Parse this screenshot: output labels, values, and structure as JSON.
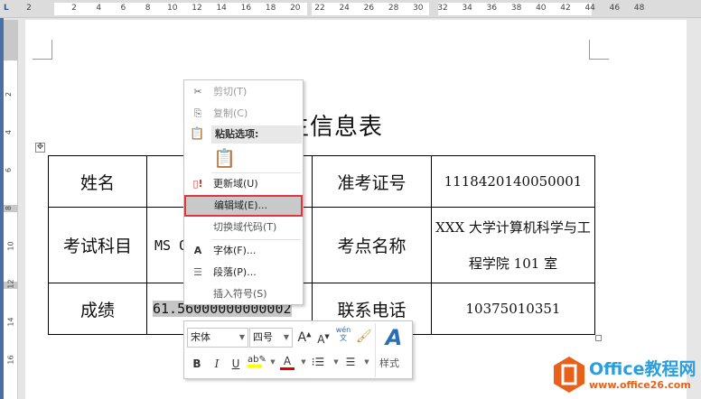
{
  "ruler": {
    "h_left": [
      "2"
    ],
    "h_numbers": [
      "2",
      "4",
      "6",
      "8",
      "10",
      "12",
      "14",
      "16",
      "18",
      "20",
      "22",
      "24",
      "26",
      "28",
      "30",
      "32",
      "34",
      "36",
      "38",
      "40",
      "42",
      "44",
      "46",
      "48"
    ],
    "v_numbers": [
      "2",
      "4",
      "6",
      "8",
      "10",
      "12",
      "14",
      "16"
    ],
    "tab_selector": "L"
  },
  "document": {
    "title": "考生信息表",
    "table": [
      [
        "姓名",
        "",
        "准考证号",
        "1118420140050001"
      ],
      [
        "考试科目",
        "MS Office",
        "考点名称",
        "XXX 大学计算机科学与工程学院 101 室"
      ],
      [
        "成绩",
        "61.56000000000002",
        "联系电话",
        "10375010351"
      ]
    ]
  },
  "context_menu": {
    "items": [
      {
        "label": "剪切(T)",
        "icon": "scissors-icon",
        "disabled": true
      },
      {
        "label": "复制(C)",
        "icon": "copy-icon",
        "disabled": true
      },
      {
        "label": "粘贴选项:",
        "icon": "paste-icon"
      },
      {
        "label": "更新域(U)",
        "icon": "update-field-icon"
      },
      {
        "label": "编辑域(E)...",
        "highlighted": true
      },
      {
        "label": "切换域代码(T)"
      },
      {
        "label": "字体(F)...",
        "icon": "font-icon"
      },
      {
        "label": "段落(P)...",
        "icon": "paragraph-icon"
      },
      {
        "label": "插入符号(S)"
      }
    ]
  },
  "mini_toolbar": {
    "font": "宋体",
    "size": "四号",
    "styles_label": "样式",
    "bold": "B",
    "italic": "I",
    "underline": "U",
    "pinyin_top": "wén",
    "pinyin_bottom": "文"
  },
  "watermark": {
    "title": "Office教程网",
    "url": "www.office26.com"
  },
  "colors": {
    "highlight": "#ffff00",
    "font_color": "#e00000",
    "accent": "#e0353b",
    "logo": "#e8611a"
  }
}
